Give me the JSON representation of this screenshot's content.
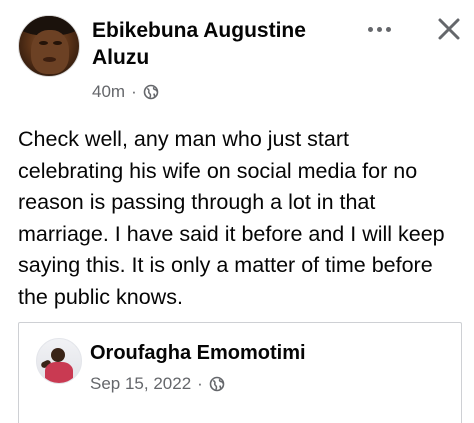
{
  "post": {
    "author": "Ebikebuna Augustine Aluzu",
    "timestamp": "40m",
    "separator": "·",
    "audience_icon": "globe-icon",
    "text": "Check well, any man who just start celebrating his wife on social media for no reason is passing through a lot in that marriage. I have said it before and I will keep saying this. It is only a matter of time before the public knows."
  },
  "header_actions": {
    "more_icon": "more-options-icon",
    "close_icon": "close-icon"
  },
  "shared_post": {
    "author": "Oroufagha Emomotimi",
    "date": "Sep 15, 2022",
    "separator": "·",
    "audience_icon": "globe-icon"
  },
  "colors": {
    "text_primary": "#050505",
    "text_secondary": "#65676b",
    "border": "#ced0d4"
  }
}
